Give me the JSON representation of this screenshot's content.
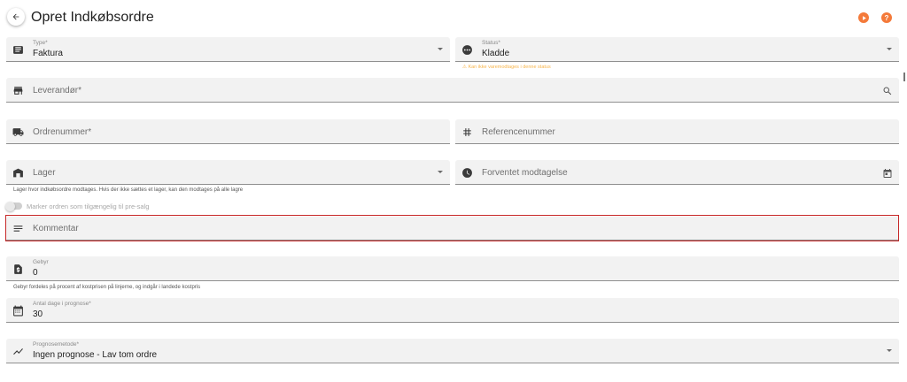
{
  "header": {
    "title": "Opret Indkøbsordre",
    "icons": [
      "arrow-back-icon",
      "play-icon",
      "help-icon"
    ],
    "help_glyph": "?"
  },
  "colors": {
    "accent": "#f47a3a",
    "warning": "#f7b54c",
    "highlight_border": "#c62828",
    "field_background": "#f2f2f2"
  },
  "form": {
    "type": {
      "label": "Type*",
      "value": "Faktura",
      "icon": "receipt-icon"
    },
    "status": {
      "label": "Status*",
      "value": "Kladde",
      "icon": "more-horiz-icon",
      "warning": "⚠ Kan ikke varemodtages i denne status"
    },
    "supplier": {
      "placeholder": "Leverandør*",
      "icon": "store-icon",
      "end_icon": "search-icon"
    },
    "order_number": {
      "placeholder": "Ordrenummer*",
      "icon": "truck-icon"
    },
    "reference_number": {
      "placeholder": "Referencenummer",
      "icon": "hash-icon"
    },
    "warehouse": {
      "placeholder": "Lager",
      "icon": "warehouse-icon",
      "helper": "Lager hvor indkøbsordre modtages. Hvis der ikke sættes et lager, kan den modtages på alle lagre"
    },
    "expected_receipt": {
      "placeholder": "Forventet modtagelse",
      "icon": "clock-icon",
      "end_icon": "calendar-icon"
    },
    "presale_toggle": {
      "label": "Marker ordren som tilgængelig til pre-salg",
      "checked": false
    },
    "comment": {
      "placeholder": "Kommentar",
      "icon": "notes-icon"
    },
    "fee": {
      "label": "Gebyr",
      "value": "0",
      "icon": "dollar-doc-icon",
      "helper": "Gebyr fordeles på procent af kostprisen på linjerne, og indgår i landede kostpris"
    },
    "forecast_days": {
      "label": "Antal dage i prognose*",
      "value": "30",
      "icon": "calendar-month-icon"
    },
    "forecast_method": {
      "label": "Prognosemetode*",
      "value": "Ingen prognose - Lav tom ordre",
      "icon": "trend-icon"
    }
  }
}
